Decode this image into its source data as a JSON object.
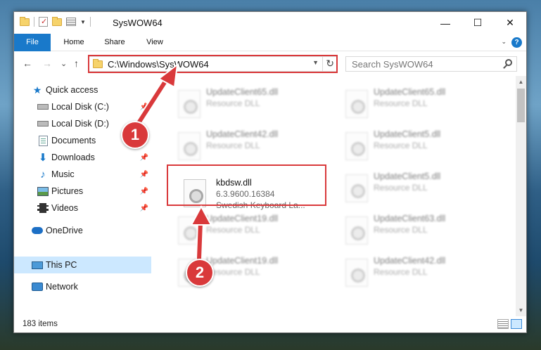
{
  "window": {
    "title": "SysWOW64",
    "controls": {
      "minimize": "—",
      "maximize": "☐",
      "close": "✕"
    }
  },
  "ribbon": {
    "tabs": [
      "File",
      "Home",
      "Share",
      "View"
    ],
    "help": "?"
  },
  "nav": {
    "back": "←",
    "forward": "→",
    "recent": "⌄",
    "up": "↑"
  },
  "address": {
    "path": "C:\\Windows\\SysWOW64",
    "refresh": "↻"
  },
  "search": {
    "placeholder": "Search SysWOW64"
  },
  "sidebar": {
    "items": [
      {
        "label": "Quick access",
        "icon": "star-icon"
      },
      {
        "label": "Local Disk (C:)",
        "icon": "drive-icon",
        "pinned": true
      },
      {
        "label": "Local Disk (D:)",
        "icon": "drive-icon",
        "pinned": false
      },
      {
        "label": "Documents",
        "icon": "documents-icon",
        "pinned": true
      },
      {
        "label": "Downloads",
        "icon": "download-icon",
        "pinned": true
      },
      {
        "label": "Music",
        "icon": "music-icon",
        "pinned": true
      },
      {
        "label": "Pictures",
        "icon": "pictures-icon",
        "pinned": true
      },
      {
        "label": "Videos",
        "icon": "videos-icon",
        "pinned": true
      },
      {
        "label": "OneDrive",
        "icon": "cloud-icon"
      },
      {
        "label": "This PC",
        "icon": "pc-icon",
        "selected": true
      },
      {
        "label": "Network",
        "icon": "network-icon"
      }
    ]
  },
  "files": [
    {
      "name": "UpdateClient65.dll",
      "type": "Resource DLL",
      "blurred": true
    },
    {
      "name": "UpdateClient65.dll",
      "type": "Resource DLL",
      "blurred": true
    },
    {
      "name": "UpdateClient42.dll",
      "type": "Resource DLL",
      "blurred": true
    },
    {
      "name": "UpdateClient5.dll",
      "type": "Resource DLL",
      "blurred": true
    },
    {
      "name": "kbdsw.dll",
      "type": "6.3.9600.16384",
      "desc": "Swedish Keyboard La...",
      "blurred": false
    },
    {
      "name": "UpdateClient5.dll",
      "type": "Resource DLL",
      "blurred": true
    },
    {
      "name": "UpdateClient19.dll",
      "type": "Resource DLL",
      "blurred": true
    },
    {
      "name": "UpdateClient63.dll",
      "type": "Resource DLL",
      "blurred": true
    },
    {
      "name": "UpdateClient19.dll",
      "type": "Resource DLL",
      "blurred": true
    },
    {
      "name": "UpdateClient42.dll",
      "type": "Resource DLL",
      "blurred": true
    }
  ],
  "status": {
    "count": "183 items"
  },
  "callouts": [
    "1",
    "2"
  ],
  "colors": {
    "accent": "#1979ca",
    "highlight": "#d9393b",
    "selected": "#cce8ff"
  }
}
